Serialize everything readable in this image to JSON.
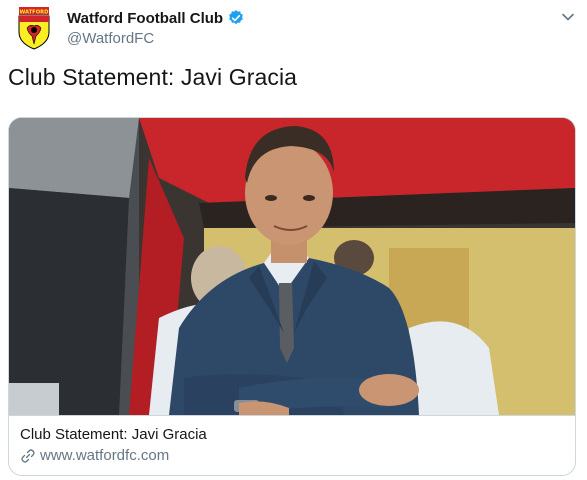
{
  "author": {
    "display_name": "Watford Football Club",
    "handle": "@WatfordFC",
    "verified": true,
    "avatar_crest_text": "WATFORD"
  },
  "tweet": {
    "text": "Club Statement: Javi Gracia"
  },
  "card": {
    "image_description": "photo",
    "title": "Club Statement: Javi Gracia",
    "domain": "www.watfordfc.com"
  },
  "icons": {
    "verified": "verified-badge-icon",
    "menu": "chevron-down-icon",
    "link": "link-icon"
  },
  "colors": {
    "verified_blue": "#1da1f2",
    "club_yellow": "#fbee23",
    "club_red": "#d2232a",
    "secondary_text": "#657786",
    "border": "#ccd6dd"
  }
}
